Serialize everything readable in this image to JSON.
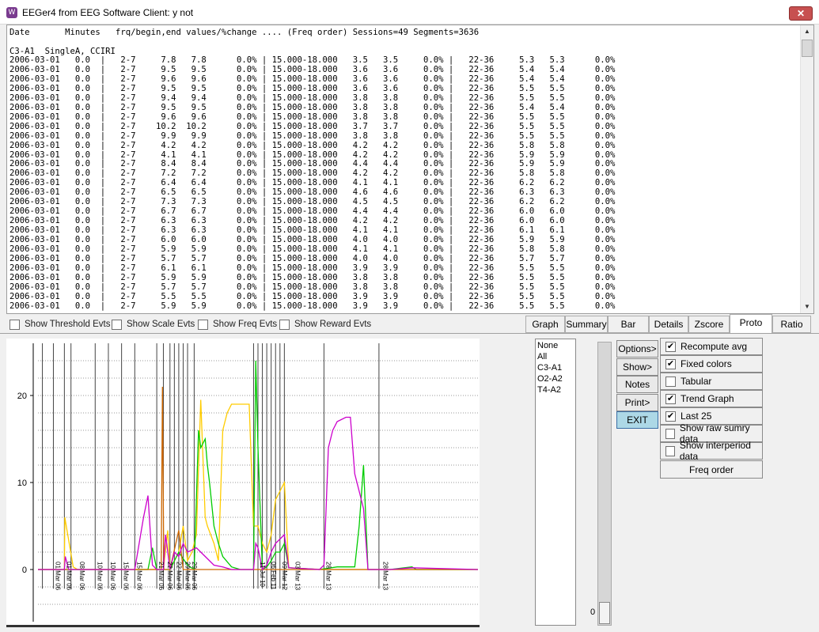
{
  "window": {
    "title": "EEGer4 from EEG Software  Client: y not",
    "close_label": "✕"
  },
  "log": {
    "header": "Date       Minutes   frq/begin,end values/%change .... (Freq order) Sessions=49 Segments=3636",
    "channel_line": "C3-A1  SingleA, CCIRI",
    "rows": [
      "2006-03-01   0.0  |   2-7     7.8   7.8      0.0% | 15.000-18.000   3.5   3.5     0.0% |   22-36     5.3   5.3      0.0%",
      "2006-03-01   0.0  |   2-7     9.5   9.5      0.0% | 15.000-18.000   3.6   3.6     0.0% |   22-36     5.4   5.4      0.0%",
      "2006-03-01   0.0  |   2-7     9.6   9.6      0.0% | 15.000-18.000   3.6   3.6     0.0% |   22-36     5.4   5.4      0.0%",
      "2006-03-01   0.0  |   2-7     9.5   9.5      0.0% | 15.000-18.000   3.6   3.6     0.0% |   22-36     5.5   5.5      0.0%",
      "2006-03-01   0.0  |   2-7     9.4   9.4      0.0% | 15.000-18.000   3.8   3.8     0.0% |   22-36     5.5   5.5      0.0%",
      "2006-03-01   0.0  |   2-7     9.5   9.5      0.0% | 15.000-18.000   3.8   3.8     0.0% |   22-36     5.4   5.4      0.0%",
      "2006-03-01   0.0  |   2-7     9.6   9.6      0.0% | 15.000-18.000   3.8   3.8     0.0% |   22-36     5.5   5.5      0.0%",
      "2006-03-01   0.0  |   2-7    10.2  10.2      0.0% | 15.000-18.000   3.7   3.7     0.0% |   22-36     5.5   5.5      0.0%",
      "2006-03-01   0.0  |   2-7     9.9   9.9      0.0% | 15.000-18.000   3.8   3.8     0.0% |   22-36     5.5   5.5      0.0%",
      "2006-03-01   0.0  |   2-7     4.2   4.2      0.0% | 15.000-18.000   4.2   4.2     0.0% |   22-36     5.8   5.8      0.0%",
      "2006-03-01   0.0  |   2-7     4.1   4.1      0.0% | 15.000-18.000   4.2   4.2     0.0% |   22-36     5.9   5.9      0.0%",
      "2006-03-01   0.0  |   2-7     8.4   8.4      0.0% | 15.000-18.000   4.4   4.4     0.0% |   22-36     5.9   5.9      0.0%",
      "2006-03-01   0.0  |   2-7     7.2   7.2      0.0% | 15.000-18.000   4.2   4.2     0.0% |   22-36     5.8   5.8      0.0%",
      "2006-03-01   0.0  |   2-7     6.4   6.4      0.0% | 15.000-18.000   4.1   4.1     0.0% |   22-36     6.2   6.2      0.0%",
      "2006-03-01   0.0  |   2-7     6.5   6.5      0.0% | 15.000-18.000   4.6   4.6     0.0% |   22-36     6.3   6.3      0.0%",
      "2006-03-01   0.0  |   2-7     7.3   7.3      0.0% | 15.000-18.000   4.5   4.5     0.0% |   22-36     6.2   6.2      0.0%",
      "2006-03-01   0.0  |   2-7     6.7   6.7      0.0% | 15.000-18.000   4.4   4.4     0.0% |   22-36     6.0   6.0      0.0%",
      "2006-03-01   0.0  |   2-7     6.3   6.3      0.0% | 15.000-18.000   4.2   4.2     0.0% |   22-36     6.0   6.0      0.0%",
      "2006-03-01   0.0  |   2-7     6.3   6.3      0.0% | 15.000-18.000   4.1   4.1     0.0% |   22-36     6.1   6.1      0.0%",
      "2006-03-01   0.0  |   2-7     6.0   6.0      0.0% | 15.000-18.000   4.0   4.0     0.0% |   22-36     5.9   5.9      0.0%",
      "2006-03-01   0.0  |   2-7     5.9   5.9      0.0% | 15.000-18.000   4.1   4.1     0.0% |   22-36     5.8   5.8      0.0%",
      "2006-03-01   0.0  |   2-7     5.7   5.7      0.0% | 15.000-18.000   4.0   4.0     0.0% |   22-36     5.7   5.7      0.0%",
      "2006-03-01   0.0  |   2-7     6.1   6.1      0.0% | 15.000-18.000   3.9   3.9     0.0% |   22-36     5.5   5.5      0.0%",
      "2006-03-01   0.0  |   2-7     5.9   5.9      0.0% | 15.000-18.000   3.8   3.8     0.0% |   22-36     5.5   5.5      0.0%",
      "2006-03-01   0.0  |   2-7     5.7   5.7      0.0% | 15.000-18.000   3.8   3.8     0.0% |   22-36     5.5   5.5      0.0%",
      "2006-03-01   0.0  |   2-7     5.5   5.5      0.0% | 15.000-18.000   3.9   3.9     0.0% |   22-36     5.5   5.5      0.0%",
      "2006-03-01   0.0  |   2-7     5.9   5.9      0.0% | 15.000-18.000   3.9   3.9     0.0% |   22-36     5.5   5.5      0.0%"
    ]
  },
  "event_checks": [
    {
      "label": "Show Threshold Evts",
      "checked": false
    },
    {
      "label": "Show Scale Evts",
      "checked": false
    },
    {
      "label": "Show Freq Evts",
      "checked": false
    },
    {
      "label": "Show Reward Evts",
      "checked": false
    }
  ],
  "tabs": [
    {
      "label": "Graph",
      "active": false
    },
    {
      "label": "Summary",
      "active": false
    },
    {
      "label": "Bar",
      "active": false
    },
    {
      "label": "Details",
      "active": false
    },
    {
      "label": "Zscore",
      "active": false
    },
    {
      "label": "Proto",
      "active": true
    },
    {
      "label": "Ratio",
      "active": false
    }
  ],
  "channel_list": [
    "None",
    "All",
    "C3-A1",
    "O2-A2",
    "T4-A2"
  ],
  "side_buttons": [
    "Options>",
    "Show>",
    "Notes",
    "Print>",
    "EXIT"
  ],
  "options": [
    {
      "label": "Recompute avg",
      "checked": true
    },
    {
      "label": "Fixed colors",
      "checked": true
    },
    {
      "label": "Tabular",
      "checked": false
    },
    {
      "label": "Trend Graph",
      "checked": true
    },
    {
      "label": "Last 25",
      "checked": true
    },
    {
      "label": "Show raw sumry data",
      "checked": false
    },
    {
      "label": "Show interperiod data",
      "checked": false
    }
  ],
  "freq_order_label": "Freq order",
  "slider_value": "0",
  "chart_data": {
    "type": "line",
    "ylim": [
      -6,
      26
    ],
    "y_ticks": [
      0,
      10,
      20
    ],
    "x_range": [
      0,
      100
    ],
    "session_markers": [
      1,
      3.5,
      6,
      7.5,
      13,
      16,
      19,
      22,
      27,
      28.5,
      30,
      31,
      32,
      33,
      34,
      35.5,
      49,
      50,
      51,
      52,
      53,
      54,
      55,
      56,
      65,
      77.5
    ],
    "date_labels": [
      {
        "x": 3.5,
        "text": "01 Mar 06"
      },
      {
        "x": 6,
        "text": "01 Mar 06"
      },
      {
        "x": 9,
        "text": "08 Mar 06"
      },
      {
        "x": 13,
        "text": "10 Mar 06"
      },
      {
        "x": 16,
        "text": "10 Mar 06"
      },
      {
        "x": 19,
        "text": "15 Mar 06"
      },
      {
        "x": 22,
        "text": "15 Mar 06"
      },
      {
        "x": 27,
        "text": "21 Mar 06"
      },
      {
        "x": 29,
        "text": "22 Mar 06"
      },
      {
        "x": 31,
        "text": "22 Mar 06"
      },
      {
        "x": 33,
        "text": "29 Mar 06"
      },
      {
        "x": 34.5,
        "text": "29 Mar 06"
      },
      {
        "x": 50,
        "text": "11 Jul 10"
      },
      {
        "x": 52.5,
        "text": "06 Feb 11"
      },
      {
        "x": 55,
        "text": "09 Mar 12"
      },
      {
        "x": 58,
        "text": "03 Mar 13"
      },
      {
        "x": 65,
        "text": "28 Mar 13"
      },
      {
        "x": 78,
        "text": "28 Mar 13"
      }
    ],
    "series": [
      {
        "color": "#ffcc00",
        "points": [
          [
            0,
            0
          ],
          [
            6,
            0
          ],
          [
            6.1,
            6
          ],
          [
            8,
            0.3
          ],
          [
            9,
            0
          ],
          [
            13,
            0
          ],
          [
            16,
            0
          ],
          [
            19,
            0
          ],
          [
            22,
            0
          ],
          [
            27,
            0
          ],
          [
            28.5,
            0
          ],
          [
            29.5,
            4.5
          ],
          [
            30,
            0
          ],
          [
            31,
            1
          ],
          [
            32,
            2
          ],
          [
            33,
            5
          ],
          [
            34,
            1
          ],
          [
            35,
            2
          ],
          [
            36,
            4
          ],
          [
            37,
            19.5
          ],
          [
            38,
            6
          ],
          [
            38.5,
            5
          ],
          [
            40,
            3
          ],
          [
            41,
            1
          ],
          [
            42,
            16
          ],
          [
            43,
            18
          ],
          [
            44,
            19
          ],
          [
            46,
            19
          ],
          [
            48,
            19
          ],
          [
            49,
            5
          ],
          [
            50,
            5
          ],
          [
            51,
            3
          ],
          [
            52,
            2
          ],
          [
            53,
            4
          ],
          [
            54,
            8
          ],
          [
            55,
            9
          ],
          [
            56,
            10
          ],
          [
            57,
            0.2
          ],
          [
            65,
            0
          ],
          [
            78,
            0
          ],
          [
            82,
            0
          ],
          [
            100,
            0
          ]
        ]
      },
      {
        "color": "#00cc00",
        "points": [
          [
            0,
            0
          ],
          [
            6,
            0
          ],
          [
            13,
            0
          ],
          [
            16,
            0
          ],
          [
            22,
            0
          ],
          [
            25,
            0
          ],
          [
            26,
            2.5
          ],
          [
            27,
            0
          ],
          [
            28.5,
            0
          ],
          [
            30,
            0
          ],
          [
            31,
            1
          ],
          [
            32,
            2
          ],
          [
            34,
            0.5
          ],
          [
            35.5,
            0
          ],
          [
            36.5,
            16
          ],
          [
            37,
            14
          ],
          [
            38,
            15
          ],
          [
            38.5,
            12
          ],
          [
            39,
            10
          ],
          [
            40,
            5
          ],
          [
            41,
            3
          ],
          [
            42,
            1.5
          ],
          [
            44,
            0.3
          ],
          [
            46,
            0
          ],
          [
            49,
            0
          ],
          [
            49.5,
            24
          ],
          [
            50,
            14
          ],
          [
            51,
            0
          ],
          [
            52,
            0.3
          ],
          [
            53,
            1
          ],
          [
            54,
            2
          ],
          [
            55,
            2
          ],
          [
            56,
            3
          ],
          [
            57,
            0.2
          ],
          [
            64,
            0
          ],
          [
            68,
            0.3
          ],
          [
            72,
            0.3
          ],
          [
            73,
            5
          ],
          [
            74,
            12
          ],
          [
            75,
            0
          ],
          [
            80,
            0
          ],
          [
            85,
            0.3
          ],
          [
            86,
            0
          ],
          [
            100,
            0
          ]
        ]
      },
      {
        "color": "#cc6600",
        "points": [
          [
            0,
            0
          ],
          [
            27,
            0
          ],
          [
            28,
            0
          ],
          [
            28.3,
            21
          ],
          [
            28.6,
            0
          ],
          [
            30,
            0
          ],
          [
            32,
            4.5
          ],
          [
            33,
            0
          ],
          [
            35,
            0
          ],
          [
            49,
            0
          ],
          [
            100,
            0
          ]
        ]
      },
      {
        "color": "#cc00cc",
        "points": [
          [
            0,
            0
          ],
          [
            6,
            0
          ],
          [
            6.2,
            1.5
          ],
          [
            7,
            0
          ],
          [
            13,
            0
          ],
          [
            16,
            0
          ],
          [
            22,
            0
          ],
          [
            24,
            6
          ],
          [
            25,
            8.5
          ],
          [
            26,
            0.5
          ],
          [
            27,
            0
          ],
          [
            28.5,
            0
          ],
          [
            29,
            4
          ],
          [
            30,
            0
          ],
          [
            31,
            2
          ],
          [
            32,
            1.5
          ],
          [
            33,
            3
          ],
          [
            34,
            2
          ],
          [
            36,
            2.5
          ],
          [
            37,
            2
          ],
          [
            38,
            1.5
          ],
          [
            40,
            0.5
          ],
          [
            42,
            0.3
          ],
          [
            44,
            0
          ],
          [
            49,
            0
          ],
          [
            49.5,
            3
          ],
          [
            50,
            2.5
          ],
          [
            51,
            0
          ],
          [
            52,
            0.5
          ],
          [
            53,
            2
          ],
          [
            54,
            3
          ],
          [
            55,
            3.5
          ],
          [
            56,
            4
          ],
          [
            57,
            0.2
          ],
          [
            64,
            0
          ],
          [
            65,
            0.5
          ],
          [
            66,
            14
          ],
          [
            67,
            16
          ],
          [
            68,
            17
          ],
          [
            70,
            17.5
          ],
          [
            71,
            17.5
          ],
          [
            72,
            11
          ],
          [
            73,
            9
          ],
          [
            74,
            7
          ],
          [
            75,
            0
          ],
          [
            80,
            0
          ],
          [
            85,
            0.2
          ],
          [
            100,
            0
          ]
        ]
      }
    ]
  }
}
